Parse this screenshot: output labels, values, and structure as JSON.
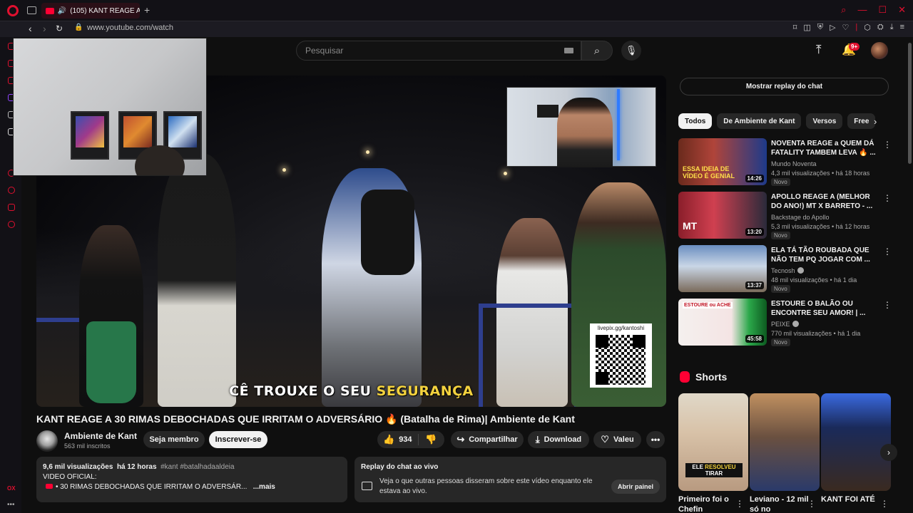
{
  "browser": {
    "tab_title": "(105) KANT REAGE A",
    "url": "www.youtube.com/watch"
  },
  "search": {
    "placeholder": "Pesquisar"
  },
  "header": {
    "notification_count": "9+"
  },
  "video": {
    "caption_white": "CÊ TROUXE O SEU ",
    "caption_yellow": "SEGURANÇA",
    "qr_label": "livepix.gg/kantoshi",
    "title": "KANT REAGE A 30 RIMAS DEBOCHADAS QUE IRRITAM O ADVERSÁRIO 🔥 (Batalha de Rima)| Ambiente de Kant"
  },
  "channel": {
    "name": "Ambiente de Kant",
    "subscribers": "563 mil inscritos",
    "member_label": "Seja membro",
    "subscribe_label": "Inscrever-se"
  },
  "actions": {
    "likes": "934",
    "share": "Compartilhar",
    "download": "Download",
    "thanks": "Valeu"
  },
  "description": {
    "views": "9,6 mil visualizações",
    "age": "há 12 horas",
    "tags": "#kant #batalhadaaldeia",
    "line2": "VIDEO OFICIAL:",
    "line3": "30 RIMAS DEBOCHADAS QUE IRRITAM O ADVERSÁR...",
    "more": "...mais"
  },
  "chat_replay_card": {
    "title": "Replay do chat ao vivo",
    "text": "Veja o que outras pessoas disseram sobre este vídeo enquanto ele estava ao vivo.",
    "button": "Abrir painel"
  },
  "sidebar": {
    "chat_replay_button": "Mostrar replay do chat",
    "chips": [
      "Todos",
      "De Ambiente de Kant",
      "Versos",
      "Free"
    ],
    "recommendations": [
      {
        "title": "NOVENTA REAGE a QUEM DÁ FATALITY TAMBEM LEVA 🔥 ...",
        "channel": "Mundo Noventa",
        "meta": "4,3 mil visualizações • há 18 horas",
        "badge": "Novo",
        "duration": "14:26",
        "verified": false
      },
      {
        "title": "APOLLO REAGE A (MELHOR DO ANO!) MT X BARRETO - ...",
        "channel": "Backstage do Apollo",
        "meta": "5,3 mil visualizações • há 12 horas",
        "badge": "Novo",
        "duration": "13:20",
        "verified": false
      },
      {
        "title": "ELA TÁ TÃO ROUBADA QUE NÃO TEM PQ JOGAR COM ...",
        "channel": "Tecnosh",
        "meta": "48 mil visualizações • há 1 dia",
        "badge": "Novo",
        "duration": "13:37",
        "verified": true
      },
      {
        "title": "ESTOURE O BALÃO OU ENCONTRE SEU AMOR! | ...",
        "channel": "PEIXE",
        "meta": "770 mil visualizações • há 1 dia",
        "badge": "Novo",
        "duration": "45:58",
        "verified": true
      }
    ],
    "thumb_texts": {
      "rec1": "ESSA IDEIA DE VÍDEO É GENIAL",
      "rec2": "MT",
      "rec4": "ESTOURE ou ACHE"
    },
    "shorts_heading": "Shorts",
    "shorts": [
      {
        "title": "Primeiro foi o Chefin",
        "overlay_1": "ELE ",
        "overlay_2": "RESOLVEU",
        "overlay_3": " TIRAR"
      },
      {
        "title": "Leviano - 12 mil só no"
      },
      {
        "title": "KANT FOI ATÉ"
      }
    ]
  },
  "colors": {
    "accent": "#ff0033",
    "opera": "#e0102f",
    "background": "#0f0f0f",
    "caption_highlight": "#f3d23e"
  }
}
